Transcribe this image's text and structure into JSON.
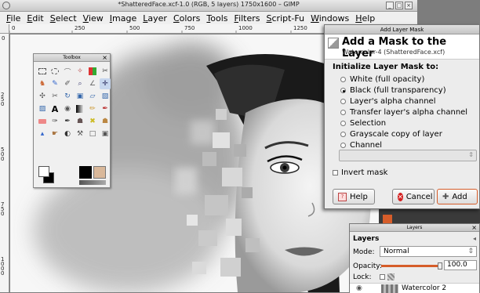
{
  "window": {
    "title": "*ShatteredFace.xcf-1.0 (RGB, 5 layers) 1750x1600 – GIMP",
    "min": "_",
    "max": "□",
    "close": "×"
  },
  "menu": [
    "File",
    "Edit",
    "Select",
    "View",
    "Image",
    "Layer",
    "Colors",
    "Tools",
    "Filters",
    "Script-Fu",
    "Windows",
    "Help"
  ],
  "ruler": {
    "top": [
      "0",
      "250",
      "500",
      "750",
      "1000",
      "1250"
    ],
    "left": [
      "0",
      "250",
      "500",
      "750",
      "1000"
    ]
  },
  "toolbox": {
    "title": "Toolbox",
    "close": "×"
  },
  "dialog": {
    "title": "Add Layer Mask",
    "heading": "Add a Mask to the Layer",
    "subtitle": "Watercolor-4 (ShatteredFace.xcf)",
    "section": "Initialize Layer Mask to:",
    "options": [
      {
        "label": "White (full opacity)",
        "selected": false
      },
      {
        "label": "Black (full transparency)",
        "selected": true
      },
      {
        "label": "Layer's alpha channel",
        "selected": false
      },
      {
        "label": "Transfer layer's alpha channel",
        "selected": false
      },
      {
        "label": "Selection",
        "selected": false
      },
      {
        "label": "Grayscale copy of layer",
        "selected": false
      },
      {
        "label": "Channel",
        "selected": false
      }
    ],
    "invert_label": "Invert mask",
    "help_label": "Help",
    "cancel_label": "Cancel",
    "add_label": "Add"
  },
  "layers": {
    "title": "Layers",
    "panel_label": "Layers",
    "mode_label": "Mode:",
    "mode_value": "Normal",
    "opacity_label": "Opacity:",
    "opacity_value": "100.0",
    "lock_label": "Lock:",
    "layer_name": "Watercolor 2"
  },
  "colors": {
    "accent": "#d65d2a",
    "cancel": "#d42020"
  }
}
